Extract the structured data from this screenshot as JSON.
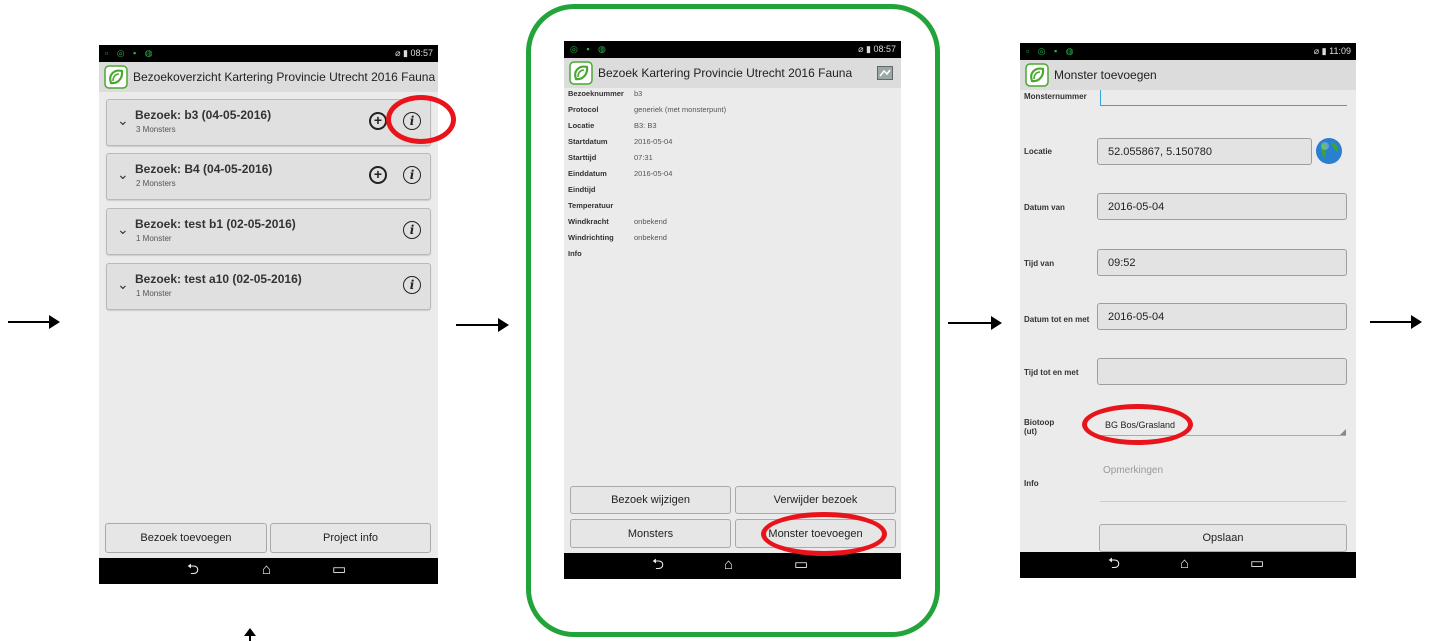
{
  "phone1": {
    "status_time": "08:57",
    "title": "Bezoekoverzicht Kartering Provincie Utrecht 2016 Fauna",
    "visits": [
      {
        "title": "Bezoek: b3 (04-05-2016)",
        "subtitle": "3 Monsters"
      },
      {
        "title": "Bezoek: B4 (04-05-2016)",
        "subtitle": "2 Monsters"
      },
      {
        "title": "Bezoek: test b1 (02-05-2016)",
        "subtitle": "1 Monster"
      },
      {
        "title": "Bezoek: test a10 (02-05-2016)",
        "subtitle": "1 Monster"
      }
    ],
    "btn_add_visit": "Bezoek toevoegen",
    "btn_project_info": "Project info"
  },
  "phone2": {
    "status_time": "08:57",
    "title": "Bezoek Kartering Provincie Utrecht 2016 Fauna",
    "details": [
      {
        "key": "Bezoeknummer",
        "value": "b3"
      },
      {
        "key": "Protocol",
        "value": "generiek (met monsterpunt)"
      },
      {
        "key": "Locatie",
        "value": "B3: B3"
      },
      {
        "key": "Startdatum",
        "value": "2016-05-04"
      },
      {
        "key": "Starttijd",
        "value": "07:31"
      },
      {
        "key": "Einddatum",
        "value": "2016-05-04"
      },
      {
        "key": "Eindtijd",
        "value": ""
      },
      {
        "key": "Temperatuur",
        "value": ""
      },
      {
        "key": "Windkracht",
        "value": "onbekend"
      },
      {
        "key": "Windrichting",
        "value": "onbekend"
      },
      {
        "key": "Info",
        "value": ""
      }
    ],
    "btn_edit": "Bezoek wijzigen",
    "btn_delete": "Verwijder bezoek",
    "btn_samples": "Monsters",
    "btn_add_sample": "Monster toevoegen"
  },
  "phone3": {
    "status_time": "11:09",
    "title": "Monster toevoegen",
    "labels": {
      "sample_number": "Monsternummer",
      "location": "Locatie",
      "date_from": "Datum van",
      "time_from": "Tijd van",
      "date_to": "Datum tot en met",
      "time_to": "Tijd tot en met",
      "biotope": "Biotoop (ut)",
      "info": "Info"
    },
    "values": {
      "location": "52.055867, 5.150780",
      "date_from": "2016-05-04",
      "time_from": "09:52",
      "date_to": "2016-05-04",
      "time_to": "",
      "biotope": "BG Bos/Grasland"
    },
    "info_placeholder": "Opmerkingen",
    "btn_save": "Opslaan"
  },
  "colors": {
    "highlight_ring": "#e8131b",
    "focus_frame": "#23a43a",
    "logo_green": "#4aa832"
  },
  "icons": [
    "chevron-down-icon",
    "plus-circle-icon",
    "info-icon",
    "map-icon",
    "globe-icon",
    "back-icon",
    "home-icon",
    "recents-icon",
    "arrow-right-icon",
    "arrow-up-icon"
  ]
}
